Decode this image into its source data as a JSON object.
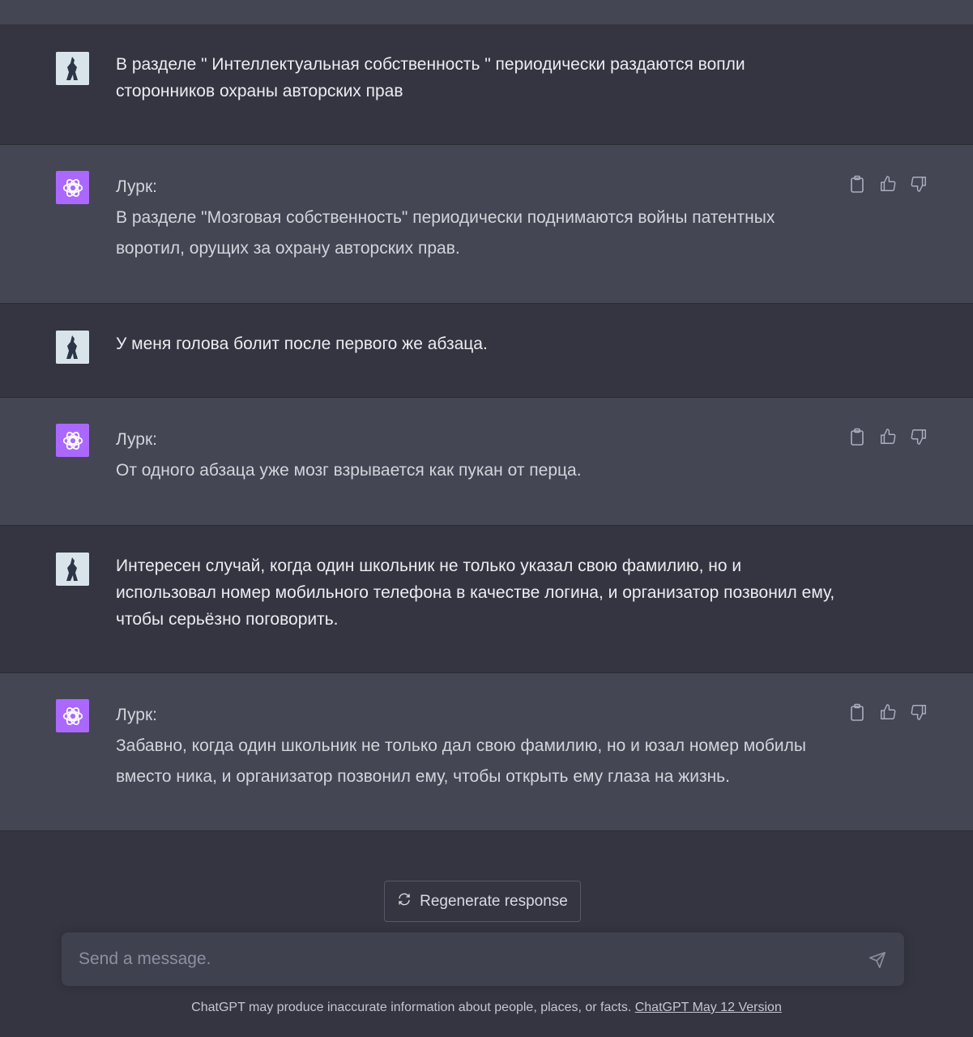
{
  "messages": [
    {
      "role": "user",
      "text": "В разделе \" Интеллектуальная собственность \" периодически раздаются вопли сторонников охраны авторских прав"
    },
    {
      "role": "assistant",
      "speaker": "Лурк:",
      "text": "В разделе \"Мозговая собственность\" периодически поднимаются войны патентных воротил, орущих за охрану авторских прав."
    },
    {
      "role": "user",
      "text": "У меня голова болит после первого же абзаца."
    },
    {
      "role": "assistant",
      "speaker": "Лурк:",
      "text": "От одного абзаца уже мозг взрывается как пукан от перца."
    },
    {
      "role": "user",
      "text": "Интересен случай, когда один школьник не только указал свою фамилию, но и использовал номер мобильного телефона в качестве логина, и организатор позвонил ему, чтобы серьёзно поговорить."
    },
    {
      "role": "assistant",
      "speaker": "Лурк:",
      "text": "Забавно, когда один школьник не только дал свою фамилию, но и юзал номер мобилы вместо ника, и организатор позвонил ему, чтобы открыть ему глаза на жизнь."
    }
  ],
  "actions": {
    "copy_icon": "clipboard-icon",
    "like_icon": "thumbs-up-icon",
    "dislike_icon": "thumbs-down-icon"
  },
  "regenerate": {
    "label": "Regenerate response",
    "icon": "refresh-icon"
  },
  "composer": {
    "placeholder": "Send a message.",
    "send_icon": "send-icon"
  },
  "footer": {
    "text": "ChatGPT may produce inaccurate information about people, places, or facts. ",
    "link": "ChatGPT May 12 Version"
  },
  "colors": {
    "background": "#343541",
    "assistant_row": "#444654",
    "assistant_avatar": "#ab68ff"
  }
}
